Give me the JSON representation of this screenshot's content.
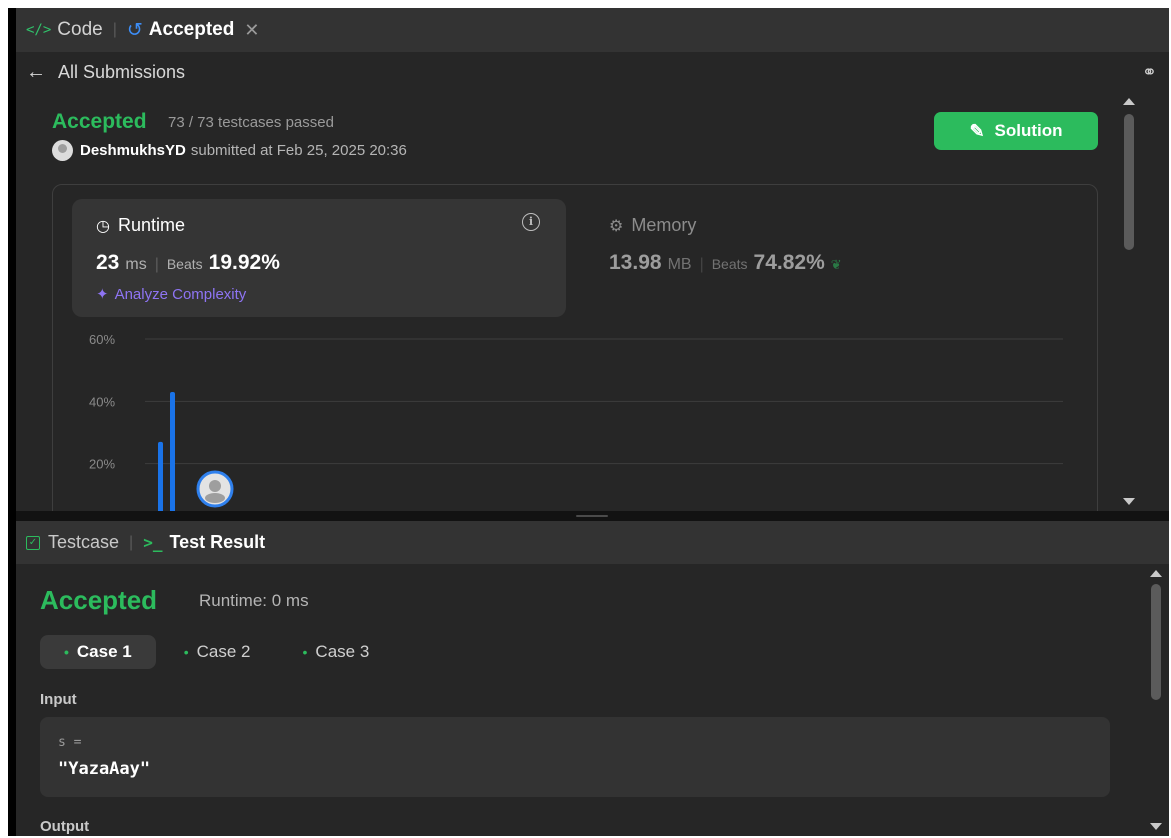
{
  "top_tabs": {
    "code_label": "Code",
    "accepted_label": "Accepted",
    "close_symbol": "✕"
  },
  "nav": {
    "back_label": "All Submissions"
  },
  "submission": {
    "status": "Accepted",
    "testcases": "73 / 73 testcases passed",
    "username": "DeshmukhsYD",
    "submitted_text": "submitted at Feb 25, 2025 20:36",
    "solution_button": "Solution"
  },
  "runtime": {
    "label": "Runtime",
    "value": "23",
    "unit": "ms",
    "beats_label": "Beats",
    "beats_value": "19.92%",
    "analyze_label": "Analyze Complexity"
  },
  "memory": {
    "label": "Memory",
    "value": "13.98",
    "unit": "MB",
    "beats_label": "Beats",
    "beats_value": "74.82%"
  },
  "chart_data": {
    "type": "bar",
    "y_ticks": [
      "60%",
      "40%",
      "20%"
    ],
    "ylim": [
      0,
      60
    ],
    "bars": [
      {
        "x": 0,
        "value": 27
      },
      {
        "x": 1,
        "value": 43
      }
    ],
    "marker_at": 2,
    "colors": {
      "bar": "#1a73e8",
      "grid": "#3d3d3d",
      "tick": "#8a8a8a"
    }
  },
  "bottom_tabs": {
    "testcase_label": "Testcase",
    "testresult_label": "Test Result"
  },
  "result": {
    "status": "Accepted",
    "runtime": "Runtime: 0 ms",
    "cases": [
      "Case 1",
      "Case 2",
      "Case 3"
    ],
    "input_label": "Input",
    "var_name": "s =",
    "var_value": "\"YazaAay\"",
    "output_label": "Output"
  },
  "colors": {
    "accent_green": "#2cbb5d",
    "accent_blue": "#3d8ef7",
    "panel_bg": "#262626",
    "tab_bg": "#333333"
  }
}
